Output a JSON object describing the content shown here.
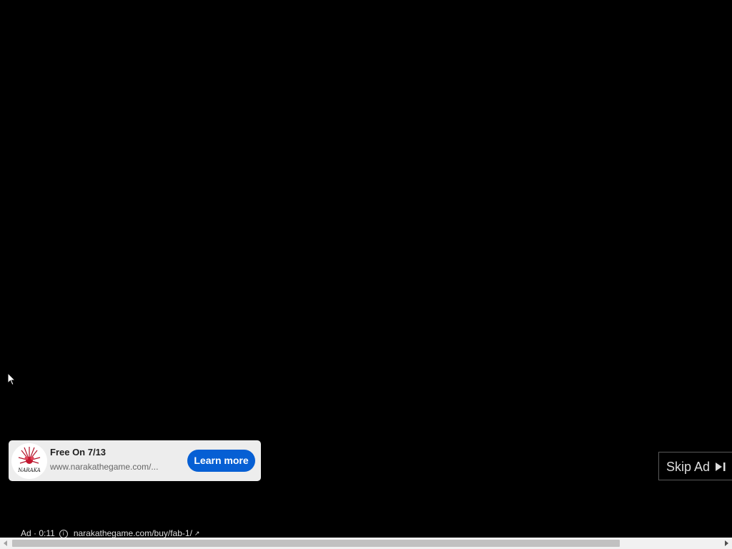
{
  "ad_card": {
    "logo_icon": "naraka-spider-lily-logo",
    "logo_text": "NARAKA",
    "title": "Free On 7/13",
    "url": "www.narakathegame.com/...",
    "cta_label": "Learn more"
  },
  "skip_button": {
    "label": "Skip Ad",
    "icon": "skip-next-icon"
  },
  "ad_info": {
    "badge": "Ad · 0:11",
    "info_icon": "info-icon",
    "link_text": "narakathegame.com/buy/fab-1/",
    "link_icon": "external-link-icon"
  },
  "colors": {
    "background": "#000000",
    "cta_blue": "#065fd4",
    "card_bg": "#ededed"
  },
  "scrollbar": {
    "thumb_fraction": 0.84
  }
}
